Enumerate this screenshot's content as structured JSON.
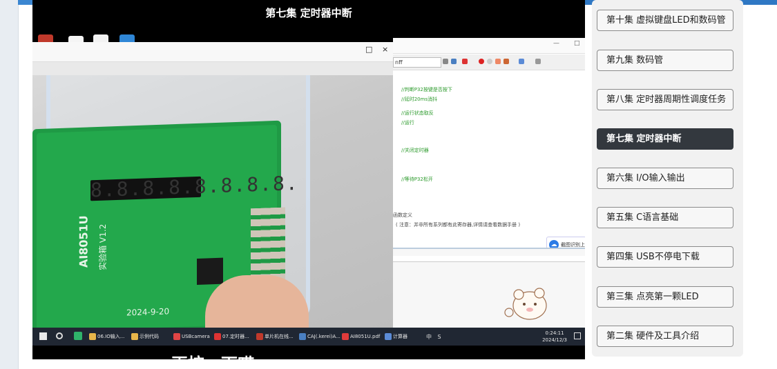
{
  "video": {
    "title": "第七集 定时器中断",
    "subtitle": "再按一下哎",
    "board_display": "8.8.8.8.8.8.8.8.",
    "board_labels": [
      "AI8051U",
      "实验箱 V1.2",
      "2024-9-20"
    ],
    "code_lines": [
      "//判断P32按键是否按下",
      "//延时20ms消抖",
      "//运行状态取反",
      "//运行",
      "//关闭定时器",
      "//等待P32松开",
      "函数定义",
      "( 注意：并非所有系列都有此寄存器,详情请查看数据手册 )"
    ],
    "toolbar_field": "nff",
    "popup_text": "截图识别上",
    "window_left_controls": [
      "□",
      "×"
    ],
    "window_right_controls": [
      "—",
      "□"
    ],
    "taskbar": {
      "items": [
        {
          "label": "06.IO输入...",
          "color": "#e8b64a"
        },
        {
          "label": "示例代码",
          "color": "#e8b64a"
        },
        {
          "label": "USBcamera",
          "color": "#e04545"
        },
        {
          "label": "07.定时器...",
          "color": "#d33"
        },
        {
          "label": "单片机在线...",
          "color": "#c0392b"
        },
        {
          "label": "CAJ(.kerei)A...",
          "color": "#4a7fc1"
        },
        {
          "label": "AI8051U.pdf",
          "color": "#e03b3b"
        },
        {
          "label": "计算器",
          "color": "#5b8bd6"
        }
      ],
      "tray": "中 S",
      "clock_time": "0:24:11",
      "clock_date": "2024/12/3"
    }
  },
  "playlist": {
    "active_index": 3,
    "episodes": [
      "第十集 虚拟键盘LED和数码管",
      "第九集 数码管",
      "第八集 定时器周期性调度任务",
      "第七集 定时器中断",
      "第六集 I/O输入输出",
      "第五集 C语言基础",
      "第四集 USB不停电下载",
      "第三集 点亮第一颗LED",
      "第二集 硬件及工具介绍"
    ]
  },
  "colors": {
    "active_episode_bg": "#33383e",
    "taskbar_bg": "#202733",
    "pcb_green": "#23a84c",
    "top_strip": "#2f78c4"
  }
}
